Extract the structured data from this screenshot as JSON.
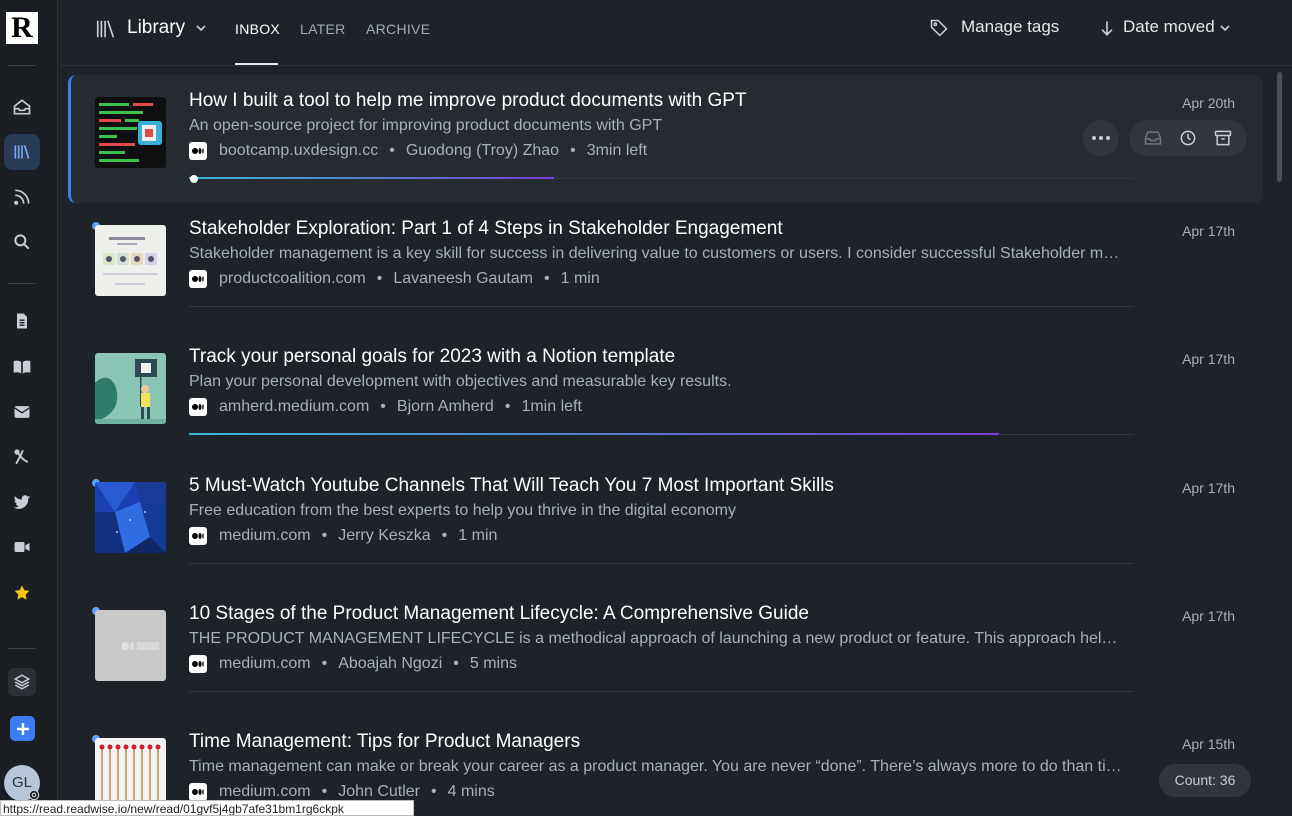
{
  "header": {
    "library_label": "Library",
    "tabs": [
      "INBOX",
      "LATER",
      "ARCHIVE"
    ],
    "manage_tags": "Manage tags",
    "sort_label": "Date moved"
  },
  "colors": {
    "accent": "#3b7cf0",
    "background": "#1e2329",
    "unread_dot": "#5aa0f5"
  },
  "sidebar": {
    "logo": "R",
    "avatar_initials": "GL",
    "icons": [
      "home-icon",
      "library-icon",
      "feed-icon",
      "search-icon",
      "document-icon",
      "book-icon",
      "email-icon",
      "pdf-icon",
      "twitter-icon",
      "video-icon",
      "star-icon",
      "layers-icon",
      "add-icon"
    ]
  },
  "items": [
    {
      "title": "How I built a tool to help me improve product documents with GPT",
      "summary": "An open-source project for improving product documents with GPT",
      "site": "bootcamp.uxdesign.cc",
      "author": "Guodong (Troy) Zhao",
      "reading": "3min left",
      "date": "Apr 20th",
      "progress": 0.36
    },
    {
      "title": "Stakeholder Exploration: Part 1 of 4 Steps in Stakeholder Engagement",
      "summary": "Stakeholder management is a key skill for success in delivering value to customers or users. I consider successful Stakeholder management to be a combination of several skills.",
      "site": "productcoalition.com",
      "author": "Lavaneesh Gautam",
      "reading": "1 min",
      "date": "Apr 17th"
    },
    {
      "title": "Track your personal goals for 2023 with a Notion template",
      "summary": "Plan your personal development with objectives and measurable key results.",
      "site": "amherd.medium.com",
      "author": "Bjorn Amherd",
      "reading": "1min left",
      "date": "Apr 17th",
      "progress": 0.8
    },
    {
      "title": "5 Must-Watch Youtube Channels That Will Teach You 7 Most Important Skills",
      "summary": "Free education from the best experts to help you thrive in the digital economy",
      "site": "medium.com",
      "author": "Jerry Keszka",
      "reading": "1 min",
      "date": "Apr 17th"
    },
    {
      "title": "10 Stages of the Product Management Lifecycle: A Comprehensive Guide",
      "summary": "THE PRODUCT MANAGEMENT LIFECYCLE is a methodical approach of launching a new product or feature. This approach helps teams plan.",
      "site": "medium.com",
      "author": "Aboajah Ngozi",
      "reading": "5 mins",
      "date": "Apr 17th"
    },
    {
      "title": "Time Management: Tips for Product Managers",
      "summary": "Time management can make or break your career as a product manager. You are never “done”. There’s always more to do than time allows.",
      "site": "medium.com",
      "author": "John Cutler",
      "reading": "4 mins",
      "date": "Apr 15th"
    }
  ],
  "count_badge": "Count: 36",
  "status_url": "https://read.readwise.io/new/read/01gvf5j4gb7afe31bm1rg6ckpk"
}
